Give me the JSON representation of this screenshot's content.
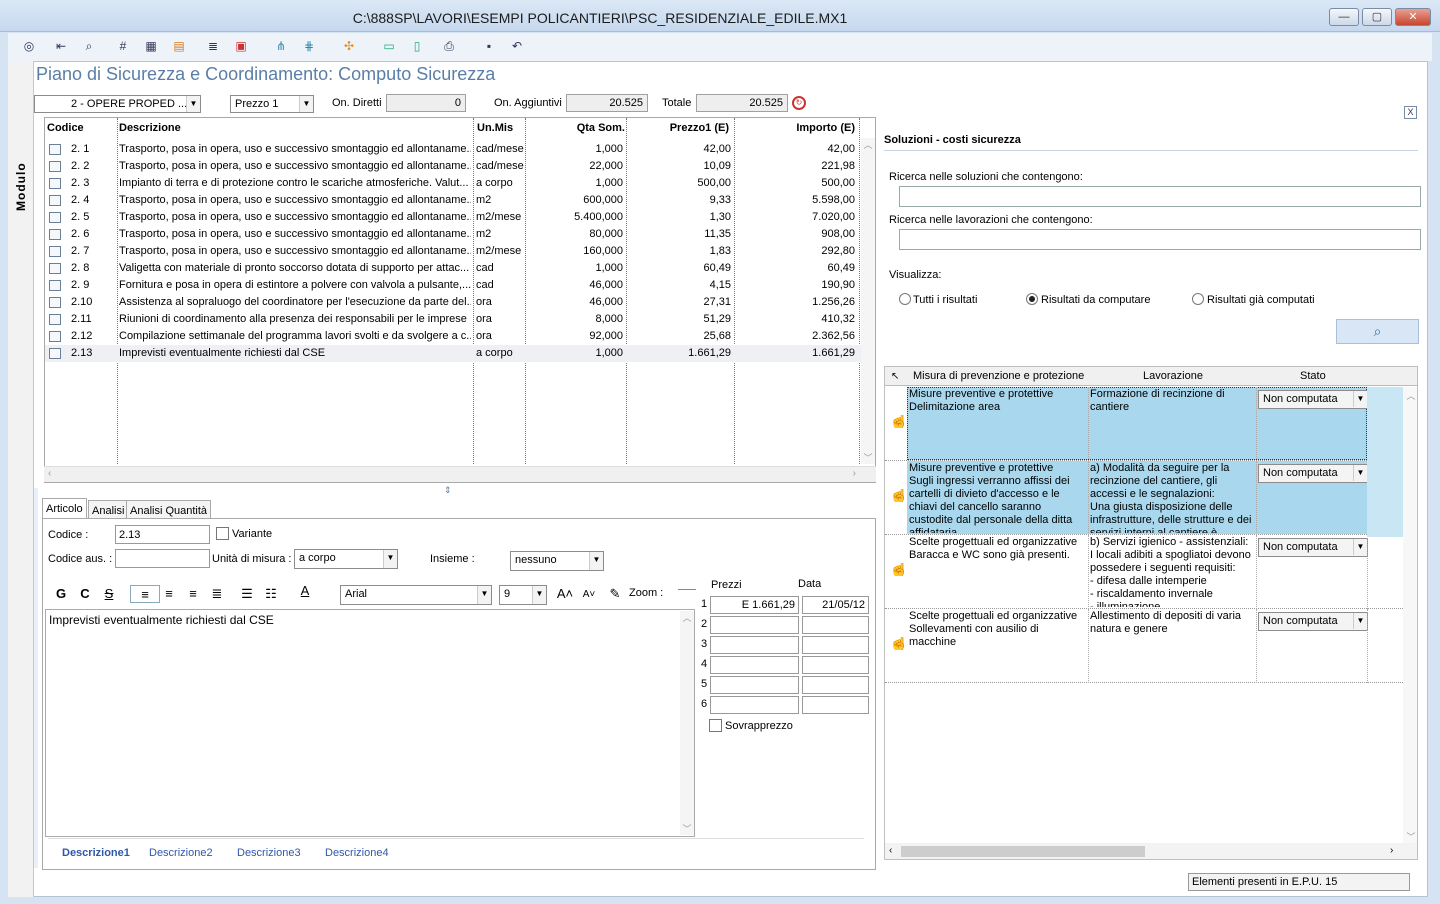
{
  "window": {
    "title": "C:\\888SP\\LAVORI\\ESEMPI POLICANTIERI\\PSC_RESIDENZIALE_EDILE.MX1",
    "minimize": "—",
    "restore": "▢",
    "close": "✕"
  },
  "sidebar": {
    "label": "Modulo"
  },
  "page": {
    "title": "Piano di Sicurezza e Coordinamento: Computo Sicurezza"
  },
  "filters": {
    "category": "2 - OPERE PROPED ...",
    "price": "Prezzo 1",
    "on_diretti_label": "On. Diretti",
    "on_diretti": "0",
    "on_aggiuntivi_label": "On. Aggiuntivi",
    "on_aggiuntivi": "20.525",
    "totale_label": "Totale",
    "totale": "20.525"
  },
  "grid": {
    "headers": {
      "codice": "Codice",
      "descrizione": "Descrizione",
      "unmis": "Un.Mis",
      "qta": "Qta Som.",
      "prezzo": "Prezzo1 (E)",
      "importo": "Importo (E)"
    },
    "rows": [
      {
        "codice": "2. 1",
        "desc": "Trasporto, posa in opera, uso e successivo smontaggio ed allontaname...",
        "um": "cad/mese",
        "qta": "1,000",
        "prezzo": "42,00",
        "importo": "42,00"
      },
      {
        "codice": "2. 2",
        "desc": "Trasporto, posa in opera, uso e successivo smontaggio ed allontaname...",
        "um": "cad/mese",
        "qta": "22,000",
        "prezzo": "10,09",
        "importo": "221,98"
      },
      {
        "codice": "2. 3",
        "desc": "Impianto di terra e di protezione contro le scariche atmosferiche. Valut...",
        "um": "a corpo",
        "qta": "1,000",
        "prezzo": "500,00",
        "importo": "500,00"
      },
      {
        "codice": "2. 4",
        "desc": "Trasporto, posa in opera, uso e successivo smontaggio ed allontaname...",
        "um": "m2",
        "qta": "600,000",
        "prezzo": "9,33",
        "importo": "5.598,00"
      },
      {
        "codice": "2. 5",
        "desc": "Trasporto, posa in opera, uso e successivo smontaggio ed allontaname...",
        "um": "m2/mese",
        "qta": "5.400,000",
        "prezzo": "1,30",
        "importo": "7.020,00"
      },
      {
        "codice": "2. 6",
        "desc": "Trasporto, posa in opera, uso e successivo smontaggio ed allontaname...",
        "um": "m2",
        "qta": "80,000",
        "prezzo": "11,35",
        "importo": "908,00"
      },
      {
        "codice": "2. 7",
        "desc": "Trasporto, posa in opera, uso e successivo smontaggio ed allontaname...",
        "um": "m2/mese",
        "qta": "160,000",
        "prezzo": "1,83",
        "importo": "292,80"
      },
      {
        "codice": "2. 8",
        "desc": "Valigetta con materiale di pronto soccorso dotata di supporto per attac...",
        "um": "cad",
        "qta": "1,000",
        "prezzo": "60,49",
        "importo": "60,49"
      },
      {
        "codice": "2. 9",
        "desc": "Fornitura e posa in opera di estintore a polvere con valvola a pulsante,...",
        "um": "cad",
        "qta": "46,000",
        "prezzo": "4,15",
        "importo": "190,90"
      },
      {
        "codice": "2.10",
        "desc": "Assistenza al sopraluogo del coordinatore per l'esecuzione da parte del...",
        "um": "ora",
        "qta": "46,000",
        "prezzo": "27,31",
        "importo": "1.256,26"
      },
      {
        "codice": "2.11",
        "desc": "Riunioni di coordinamento alla presenza dei responsabili per le imprese ...",
        "um": "ora",
        "qta": "8,000",
        "prezzo": "51,29",
        "importo": "410,32"
      },
      {
        "codice": "2.12",
        "desc": "Compilazione settimanale del programma lavori svolti e da svolgere a c...",
        "um": "ora",
        "qta": "92,000",
        "prezzo": "25,68",
        "importo": "2.362,56"
      },
      {
        "codice": "2.13",
        "desc": "Imprevisti eventualmente richiesti dal CSE",
        "um": "a corpo",
        "qta": "1,000",
        "prezzo": "1.661,29",
        "importo": "1.661,29"
      }
    ]
  },
  "tabs": {
    "articolo": "Articolo",
    "analisi": "Analisi",
    "analisi_qta": "Analisi Quantità"
  },
  "article": {
    "codice_label": "Codice :",
    "codice": "2.13",
    "variante": "Variante",
    "codice_aus_label": "Codice aus. :",
    "um_label": "Unità di misura :",
    "um": "a corpo",
    "insieme_label": "Insieme :",
    "insieme": "nessuno"
  },
  "editor": {
    "bold": "G",
    "italic": "C",
    "strike": "S",
    "font": "Arial",
    "size": "9",
    "zoom_label": "Zoom :",
    "text": "Imprevisti eventualmente richiesti dal CSE"
  },
  "prices": {
    "prezzi_label": "Prezzi",
    "data_label": "Data",
    "rows": [
      {
        "n": "1",
        "prezzo": "E  1.661,29",
        "data": "21/05/12"
      },
      {
        "n": "2",
        "prezzo": "",
        "data": ""
      },
      {
        "n": "3",
        "prezzo": "",
        "data": ""
      },
      {
        "n": "4",
        "prezzo": "",
        "data": ""
      },
      {
        "n": "5",
        "prezzo": "",
        "data": ""
      },
      {
        "n": "6",
        "prezzo": "",
        "data": ""
      }
    ],
    "sovrapprezzo": "Sovrapprezzo"
  },
  "desc_tabs": [
    "Descrizione1",
    "Descrizione2",
    "Descrizione3",
    "Descrizione4"
  ],
  "solutions": {
    "title": "Soluzioni - costi sicurezza",
    "close": "X",
    "search1_label": "Ricerca nelle soluzioni che contengono:",
    "search2_label": "Ricerca nelle lavorazioni che contengono:",
    "visualizza": "Visualizza:",
    "radios": [
      "Tutti i risultati",
      "Risultati da computare",
      "Risultati già computati"
    ],
    "headers": {
      "misura": "Misura di prevenzione e protezione",
      "lavorazione": "Lavorazione",
      "stato": "Stato"
    },
    "rows": [
      {
        "misura": "Misure preventive e protettive\nDelimitazione area",
        "lav": "Formazione di recinzione di cantiere",
        "stato": "Non computata"
      },
      {
        "misura": "Misure preventive e protettive\nSugli ingressi verranno affissi dei cartelli di divieto d'accesso e le chiavi del cancello saranno custodite dal personale della ditta affidataria.\nSopra la recinzione fissa dei",
        "lav": "a) Modalità da seguire per la recinzione del cantiere, gli accessi e le segnalazioni:\nUna giusta disposizione delle infrastrutture, delle strutture e dei servizi interni al cantiere è",
        "stato": "Non computata"
      },
      {
        "misura": "Scelte progettuali ed organizzative\nBaracca e WC sono già presenti.",
        "lav": "b) Servizi igienico - assistenziali:\nI locali adibiti a spogliatoi devono possedere i seguenti requisiti:\n- difesa dalle intemperie\n- riscaldamento invernale\n- illuminazione",
        "stato": "Non computata"
      },
      {
        "misura": "Scelte progettuali ed organizzative\nSollevamenti con ausilio di macchine",
        "lav": "Allestimento di depositi di varia natura e genere",
        "stato": "Non computata"
      }
    ]
  },
  "status": {
    "text": "Elementi presenti in E.P.U. 15"
  }
}
